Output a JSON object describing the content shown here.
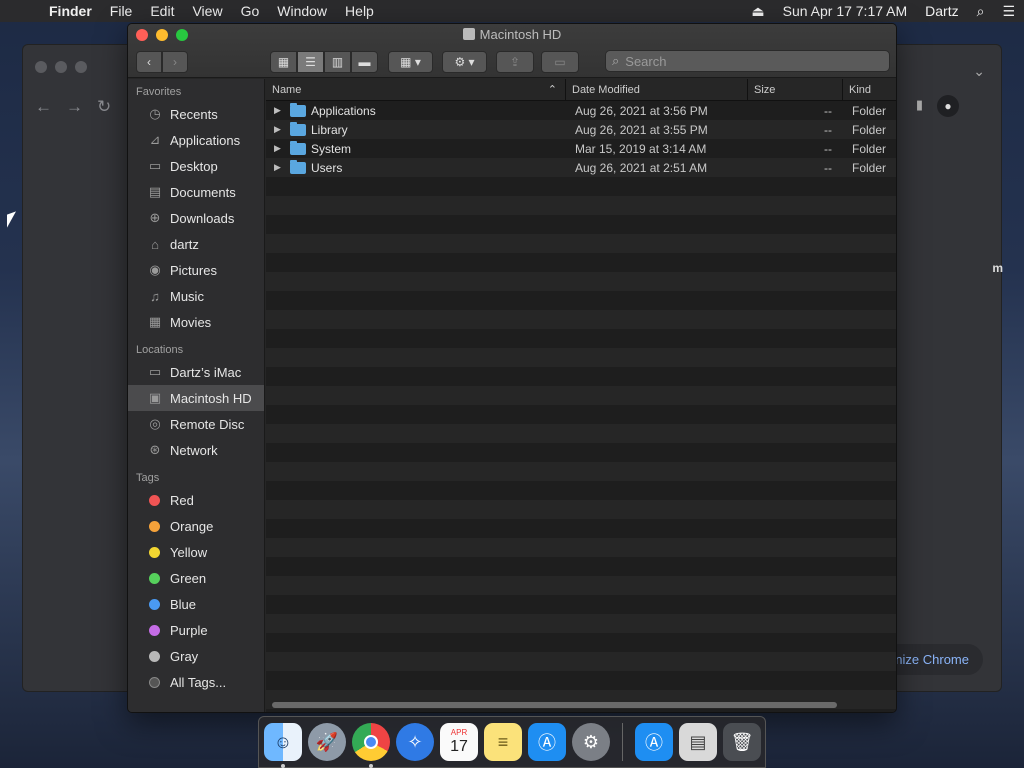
{
  "menubar": {
    "app": "Finder",
    "menus": [
      "File",
      "Edit",
      "View",
      "Go",
      "Window",
      "Help"
    ],
    "datetime": "Sun Apr 17  7:17 AM",
    "user": "Dartz"
  },
  "chrome": {
    "customize_label": "nize Chrome",
    "edge_text": "m"
  },
  "finder": {
    "title": "Macintosh HD",
    "search_placeholder": "Search",
    "sidebar": {
      "favorites_label": "Favorites",
      "favorites": [
        {
          "label": "Recents",
          "icon": "clock-icon"
        },
        {
          "label": "Applications",
          "icon": "applications-icon"
        },
        {
          "label": "Desktop",
          "icon": "desktop-icon"
        },
        {
          "label": "Documents",
          "icon": "document-icon"
        },
        {
          "label": "Downloads",
          "icon": "download-icon"
        },
        {
          "label": "dartz",
          "icon": "home-icon"
        },
        {
          "label": "Pictures",
          "icon": "camera-icon"
        },
        {
          "label": "Music",
          "icon": "music-icon"
        },
        {
          "label": "Movies",
          "icon": "film-icon"
        }
      ],
      "locations_label": "Locations",
      "locations": [
        {
          "label": "Dartz’s iMac",
          "icon": "imac-icon"
        },
        {
          "label": "Macintosh HD",
          "icon": "disk-icon"
        },
        {
          "label": "Remote Disc",
          "icon": "disc-icon"
        },
        {
          "label": "Network",
          "icon": "globe-icon"
        }
      ],
      "tags_label": "Tags",
      "tags": [
        {
          "label": "Red",
          "color": "#f05454"
        },
        {
          "label": "Orange",
          "color": "#f5a23a"
        },
        {
          "label": "Yellow",
          "color": "#f3d631"
        },
        {
          "label": "Green",
          "color": "#56d05c"
        },
        {
          "label": "Blue",
          "color": "#4a9af2"
        },
        {
          "label": "Purple",
          "color": "#c56ce6"
        },
        {
          "label": "Gray",
          "color": "#b8b8b8"
        },
        {
          "label": "All Tags...",
          "color": "#555555"
        }
      ]
    },
    "columns": {
      "name": "Name",
      "date": "Date Modified",
      "size": "Size",
      "kind": "Kind"
    },
    "rows": [
      {
        "name": "Applications",
        "date": "Aug 26, 2021 at 3:56 PM",
        "size": "--",
        "kind": "Folder"
      },
      {
        "name": "Library",
        "date": "Aug 26, 2021 at 3:55 PM",
        "size": "--",
        "kind": "Folder"
      },
      {
        "name": "System",
        "date": "Mar 15, 2019 at 3:14 AM",
        "size": "--",
        "kind": "Folder"
      },
      {
        "name": "Users",
        "date": "Aug 26, 2021 at 2:51 AM",
        "size": "--",
        "kind": "Folder"
      }
    ]
  },
  "dock": {
    "calendar_month": "APR",
    "calendar_day": "17"
  }
}
